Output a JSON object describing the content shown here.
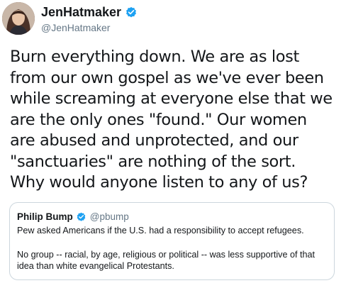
{
  "tweet": {
    "display_name": "JenHatmaker",
    "handle": "@JenHatmaker",
    "verified": true,
    "text_lines": [
      "Burn everything down. We are as lost",
      "from our own gospel as we've ever been",
      "while screaming at everyone else that we",
      "are the only ones \"found.\" Our women",
      "are abused and unprotected, and our",
      "\"sanctuaries\" are nothing of the sort.",
      "Why would anyone listen to any of us?"
    ]
  },
  "quoted_tweet": {
    "display_name": "Philip Bump",
    "handle": "@pbump",
    "verified": true,
    "paragraph_1": "Pew asked Americans if the U.S. had a responsibility to accept refugees.",
    "paragraph_2_lines": [
      "No group -- racial, by age, religious or political -- was less supportive of that",
      "idea than white evangelical Protestants."
    ]
  },
  "colors": {
    "text": "#14171a",
    "secondary": "#657786",
    "verified_blue": "#1da1f2",
    "border": "#ccd6dd"
  },
  "icons": {
    "verified": "verified-badge-icon",
    "avatar": "profile-photo"
  }
}
